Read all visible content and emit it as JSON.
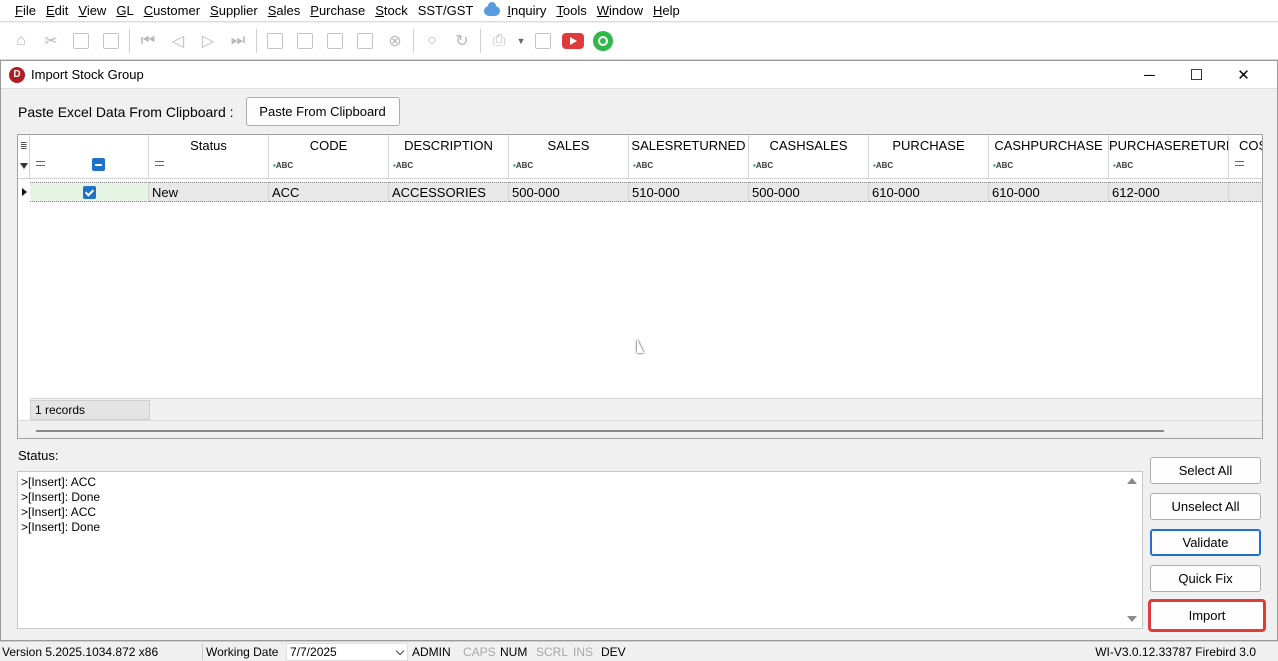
{
  "menu": [
    {
      "label": "File",
      "u": "F",
      "rest": "ile"
    },
    {
      "label": "Edit",
      "u": "E",
      "rest": "dit"
    },
    {
      "label": "View",
      "u": "V",
      "rest": "iew"
    },
    {
      "label": "GL",
      "u": "G",
      "rest": "L"
    },
    {
      "label": "Customer",
      "u": "C",
      "rest": "ustomer"
    },
    {
      "label": "Supplier",
      "u": "S",
      "rest": "upplier"
    },
    {
      "label": "Sales",
      "u": "S",
      "rest": "ales"
    },
    {
      "label": "Purchase",
      "u": "P",
      "rest": "urchase"
    },
    {
      "label": "Stock",
      "u": "S",
      "rest": "tock"
    },
    {
      "label": "SST/GST",
      "u": "",
      "rest": "SST/GST"
    },
    {
      "label": "Inquiry",
      "u": "I",
      "rest": "nquiry"
    },
    {
      "label": "Tools",
      "u": "T",
      "rest": "ools"
    },
    {
      "label": "Window",
      "u": "W",
      "rest": "indow"
    },
    {
      "label": "Help",
      "u": "H",
      "rest": "elp"
    }
  ],
  "window": {
    "title": "Import Stock Group",
    "logo_letter": "D",
    "minimize_glyph": "─",
    "maximize_glyph": "☐",
    "close_glyph": "✕"
  },
  "paste": {
    "label": "Paste Excel Data From Clipboard :",
    "button": "Paste From Clipboard"
  },
  "grid": {
    "columns": [
      "",
      "Status",
      "CODE",
      "DESCRIPTION",
      "SALES",
      "SALESRETURNED",
      "CASHSALES",
      "PURCHASE",
      "CASHPURCHASE",
      "PURCHASERETURN...",
      "COS"
    ],
    "filter_text": "ABC",
    "rows": [
      {
        "selected": true,
        "status": "New",
        "code": "ACC",
        "description": "ACCESSORIES",
        "sales": "500-000",
        "salesreturned": "510-000",
        "cashsales": "500-000",
        "purchase": "610-000",
        "cashpurchase": "610-000",
        "purchasereturn": "612-000",
        "cos": ""
      }
    ],
    "record_count": "1 records"
  },
  "status": {
    "label": "Status:",
    "lines": [
      ">[Insert]: ACC",
      ">[Insert]: Done",
      ">[Insert]: ACC",
      ">[Insert]: Done"
    ]
  },
  "buttons": {
    "select_all": "Select All",
    "unselect_all": "Unselect All",
    "validate": "Validate",
    "quick_fix": "Quick Fix",
    "import": "Import"
  },
  "statusbar": {
    "version": "Version 5.2025.1034.872 x86",
    "working_date_label": "Working Date",
    "working_date": "7/7/2025",
    "user": "ADMIN",
    "caps": "CAPS",
    "num": "NUM",
    "scrl": "SCRL",
    "ins": "INS",
    "dev": "DEV",
    "server": "WI-V3.0.12.33787 Firebird 3.0"
  },
  "colors": {
    "accent": "#1e72c8",
    "import_highlight": "#e03c3c",
    "youtube": "#e03a3a",
    "whatsapp": "#2fb84a"
  }
}
